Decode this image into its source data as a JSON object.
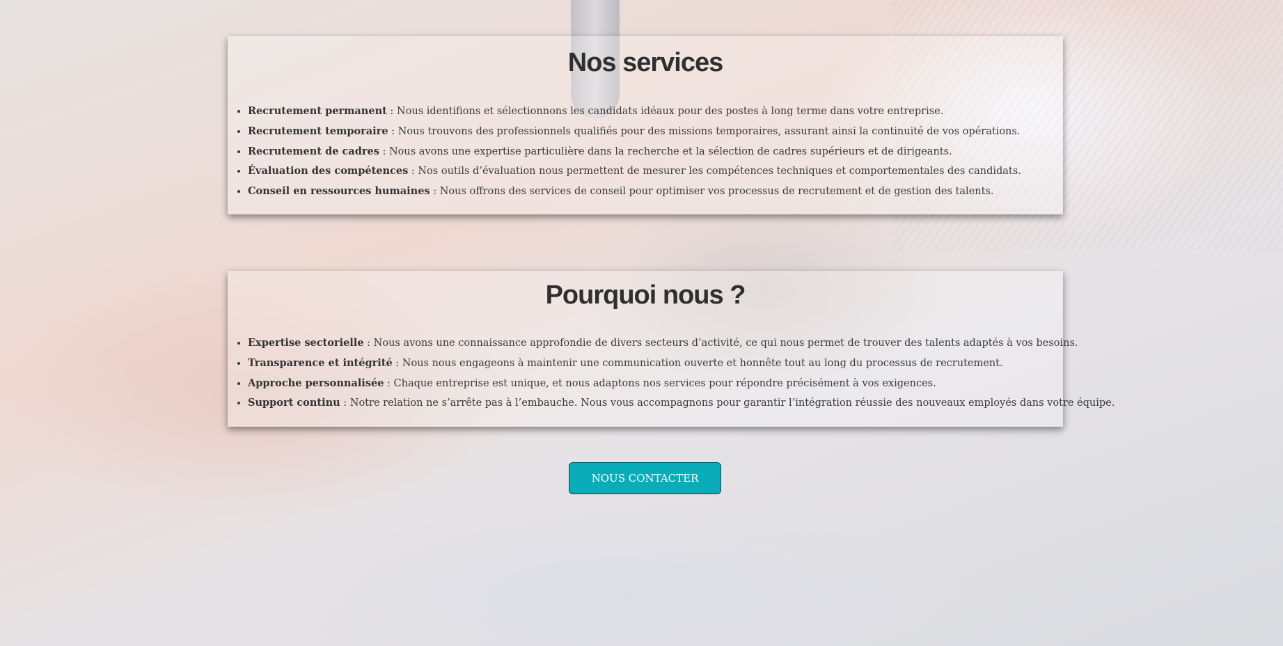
{
  "services": {
    "title": "Nos services",
    "items": [
      {
        "term": "Recrutement permanent",
        "desc": " : Nous identifions et sélectionnons les candidats idéaux pour des postes à long terme dans votre entreprise."
      },
      {
        "term": "Recrutement temporaire",
        "desc": " : Nous trouvons des professionnels qualifiés pour des missions temporaires, assurant ainsi la continuité de vos opérations."
      },
      {
        "term": "Recrutement de cadres",
        "desc": " : Nous avons une expertise particulière dans la recherche et la sélection de cadres supérieurs et de dirigeants."
      },
      {
        "term": "Évaluation des compétences",
        "desc": " : Nos outils d’évaluation nous permettent de mesurer les compétences techniques et comportementales des candidats."
      },
      {
        "term": "Conseil en ressources humaines",
        "desc": " : Nous offrons des services de conseil pour optimiser vos processus de recrutement et de gestion des talents."
      }
    ]
  },
  "why": {
    "title": "Pourquoi nous ?",
    "items": [
      {
        "term": "Expertise sectorielle",
        "desc": " : Nous avons une connaissance approfondie de divers secteurs d’activité, ce qui nous permet de trouver des talents adaptés à vos besoins."
      },
      {
        "term": "Transparence et intégrité",
        "desc": " : Nous nous engageons à maintenir une communication ouverte et honnête tout au long du processus de recrutement."
      },
      {
        "term": "Approche personnalisée",
        "desc": " : Chaque entreprise est unique, et nous adaptons nos services pour répondre précisément à vos exigences."
      },
      {
        "term": "Support continu",
        "desc": " : Notre relation ne s’arrête pas à l’embauche. Nous vous accompagnons pour garantir l’intégration réussie des nouveaux employés dans votre équipe."
      }
    ]
  },
  "cta": {
    "label": "Nous contacter",
    "color": "#08adb9"
  },
  "background": {
    "image": "hands-signing-document-photo"
  }
}
